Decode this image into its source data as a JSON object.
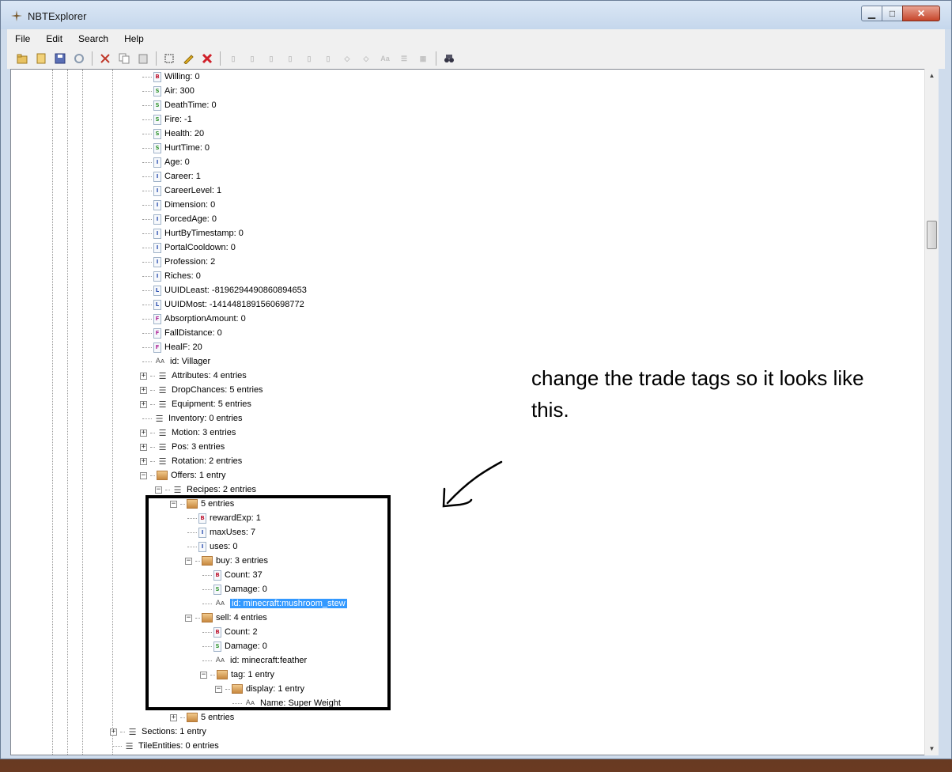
{
  "window": {
    "title": "NBTExplorer"
  },
  "menu": [
    "File",
    "Edit",
    "Search",
    "Help"
  ],
  "window_controls": {
    "minimize": "▁",
    "maximize": "□",
    "close": "✕"
  },
  "scrollbar": {
    "up": "▲",
    "down": "▼"
  },
  "tree": [
    {
      "level": 0,
      "kind": "B",
      "text": "Willing: 0"
    },
    {
      "level": 0,
      "kind": "S",
      "text": "Air: 300"
    },
    {
      "level": 0,
      "kind": "S",
      "text": "DeathTime: 0"
    },
    {
      "level": 0,
      "kind": "S",
      "text": "Fire: -1"
    },
    {
      "level": 0,
      "kind": "S",
      "text": "Health: 20"
    },
    {
      "level": 0,
      "kind": "S",
      "text": "HurtTime: 0"
    },
    {
      "level": 0,
      "kind": "I",
      "text": "Age: 0"
    },
    {
      "level": 0,
      "kind": "I",
      "text": "Career: 1"
    },
    {
      "level": 0,
      "kind": "I",
      "text": "CareerLevel: 1"
    },
    {
      "level": 0,
      "kind": "I",
      "text": "Dimension: 0"
    },
    {
      "level": 0,
      "kind": "I",
      "text": "ForcedAge: 0"
    },
    {
      "level": 0,
      "kind": "I",
      "text": "HurtByTimestamp: 0"
    },
    {
      "level": 0,
      "kind": "I",
      "text": "PortalCooldown: 0"
    },
    {
      "level": 0,
      "kind": "I",
      "text": "Profession: 2"
    },
    {
      "level": 0,
      "kind": "I",
      "text": "Riches: 0"
    },
    {
      "level": 0,
      "kind": "L",
      "text": "UUIDLeast: -8196294490860894653"
    },
    {
      "level": 0,
      "kind": "L",
      "text": "UUIDMost: -1414481891560698772"
    },
    {
      "level": 0,
      "kind": "F",
      "text": "AbsorptionAmount: 0"
    },
    {
      "level": 0,
      "kind": "F",
      "text": "FallDistance: 0"
    },
    {
      "level": 0,
      "kind": "F",
      "text": "HealF: 20"
    },
    {
      "level": 0,
      "kind": "STR",
      "text": "id: Villager"
    },
    {
      "level": 0,
      "kind": "LIST",
      "text": "Attributes: 4 entries",
      "exp": "+"
    },
    {
      "level": 0,
      "kind": "LIST",
      "text": "DropChances: 5 entries",
      "exp": "+"
    },
    {
      "level": 0,
      "kind": "LIST",
      "text": "Equipment: 5 entries",
      "exp": "+"
    },
    {
      "level": 0,
      "kind": "LIST",
      "text": "Inventory: 0 entries"
    },
    {
      "level": 0,
      "kind": "LIST",
      "text": "Motion: 3 entries",
      "exp": "+"
    },
    {
      "level": 0,
      "kind": "LIST",
      "text": "Pos: 3 entries",
      "exp": "+"
    },
    {
      "level": 0,
      "kind": "LIST",
      "text": "Rotation: 2 entries",
      "exp": "+"
    },
    {
      "level": 0,
      "kind": "COMP",
      "text": "Offers: 1 entry",
      "exp": "-"
    },
    {
      "level": 1,
      "kind": "LIST",
      "text": "Recipes: 2 entries",
      "exp": "-"
    },
    {
      "level": 2,
      "kind": "COMP",
      "text": "5 entries",
      "exp": "-"
    },
    {
      "level": 3,
      "kind": "B",
      "text": "rewardExp: 1"
    },
    {
      "level": 3,
      "kind": "I",
      "text": "maxUses: 7"
    },
    {
      "level": 3,
      "kind": "I",
      "text": "uses: 0"
    },
    {
      "level": 3,
      "kind": "COMP",
      "text": "buy: 3 entries",
      "exp": "-"
    },
    {
      "level": 4,
      "kind": "B",
      "text": "Count: 37"
    },
    {
      "level": 4,
      "kind": "S",
      "text": "Damage: 0"
    },
    {
      "level": 4,
      "kind": "STR",
      "text": "id: minecraft:mushroom_stew",
      "selected": true
    },
    {
      "level": 3,
      "kind": "COMP",
      "text": "sell: 4 entries",
      "exp": "-"
    },
    {
      "level": 4,
      "kind": "B",
      "text": "Count: 2"
    },
    {
      "level": 4,
      "kind": "S",
      "text": "Damage: 0"
    },
    {
      "level": 4,
      "kind": "STR",
      "text": "id: minecraft:feather"
    },
    {
      "level": 4,
      "kind": "COMP",
      "text": "tag: 1 entry",
      "exp": "-"
    },
    {
      "level": 5,
      "kind": "COMP",
      "text": "display: 1 entry",
      "exp": "-"
    },
    {
      "level": 6,
      "kind": "STR",
      "text": "Name: Super Weight"
    },
    {
      "level": 2,
      "kind": "COMP",
      "text": "5 entries",
      "exp": "+"
    },
    {
      "level": -2,
      "kind": "LIST",
      "text": "Sections: 1 entry",
      "exp": "+"
    },
    {
      "level": -2,
      "kind": "LIST",
      "text": "TileEntities: 0 entries"
    }
  ],
  "annotation": {
    "text": "change the trade tags so it looks like this."
  }
}
